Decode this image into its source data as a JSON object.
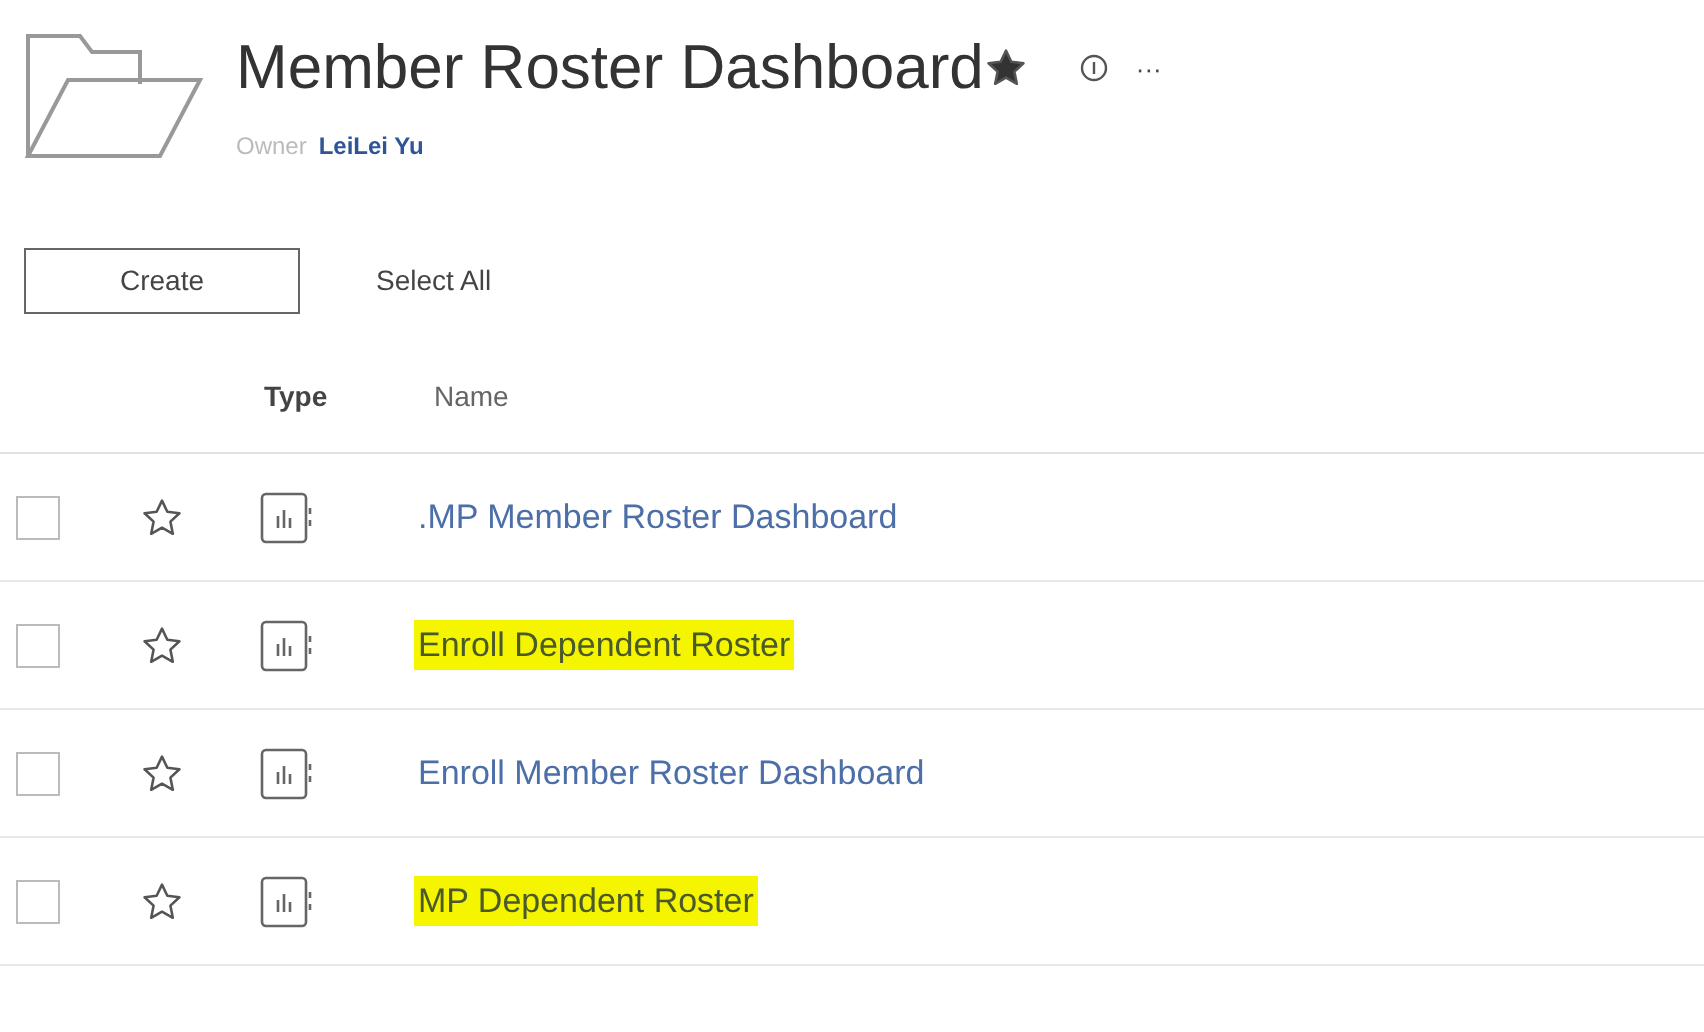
{
  "header": {
    "title": "Member Roster Dashboard",
    "owner_label": "Owner",
    "owner": "LeiLei Yu",
    "more": "···"
  },
  "toolbar": {
    "create": "Create",
    "select_all": "Select All"
  },
  "table": {
    "columns": [
      "Type",
      "Name"
    ],
    "rows": [
      {
        "name": ".MP Member Roster Dashboard",
        "highlighted": false,
        "checked": false,
        "favorite": false
      },
      {
        "name": "Enroll Dependent Roster",
        "highlighted": true,
        "checked": false,
        "favorite": false
      },
      {
        "name": "Enroll Member Roster Dashboard",
        "highlighted": false,
        "checked": false,
        "favorite": false
      },
      {
        "name": "MP Dependent Roster",
        "highlighted": true,
        "checked": false,
        "favorite": false
      }
    ]
  }
}
